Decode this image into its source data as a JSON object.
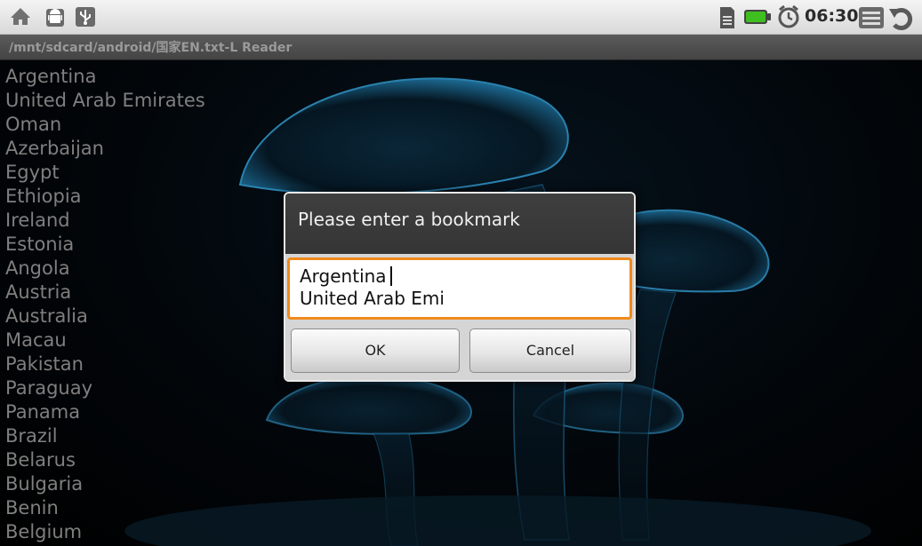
{
  "status_bar": {
    "time": "06:30",
    "icons": [
      "home-icon",
      "android-debug-icon",
      "usb-icon",
      "sdcard-icon",
      "battery-icon",
      "alarm-icon",
      "menu-icon",
      "back-icon"
    ]
  },
  "title_bar": {
    "path": "/mnt/sdcard/android/国家EN.txt-L Reader"
  },
  "countries": [
    "Argentina",
    "United Arab Emirates",
    "Oman",
    "Azerbaijan",
    "Egypt",
    "Ethiopia",
    "Ireland",
    "Estonia",
    "Angola",
    "Austria",
    "Australia",
    "Macau",
    "Pakistan",
    "Paraguay",
    "Panama",
    "Brazil",
    "Belarus",
    "Bulgaria",
    "Benin",
    "Belgium"
  ],
  "dialog": {
    "title": "Please enter a bookmark",
    "input_lines": [
      "Argentina",
      "United Arab Emi"
    ],
    "ok_label": "OK",
    "cancel_label": "Cancel"
  },
  "colors": {
    "input_focus_border": "#f08a1c",
    "list_text": "#7f7f7f",
    "battery": "#3fbf1f"
  }
}
